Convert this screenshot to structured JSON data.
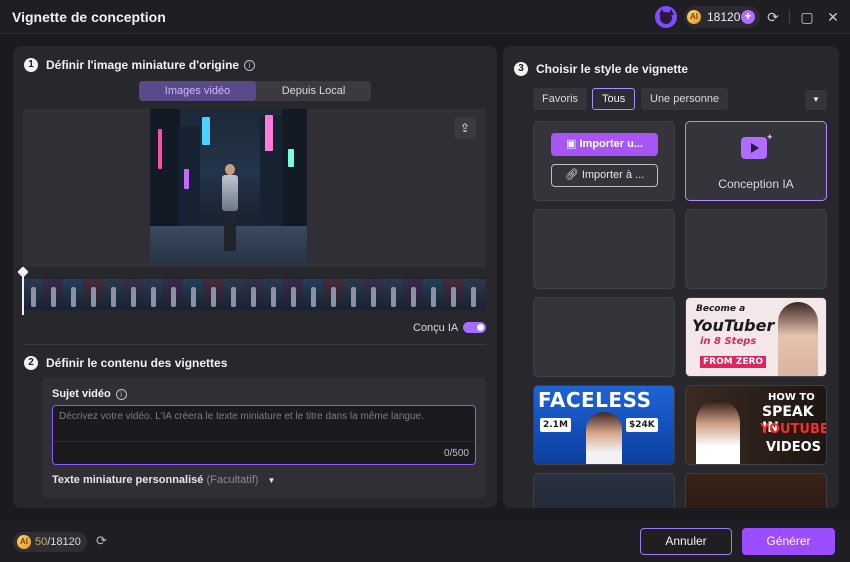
{
  "window": {
    "title": "Vignette de conception",
    "credits_balance": "18120"
  },
  "section1": {
    "number": "1",
    "title": "Définir l'image miniature d'origine",
    "tabs": [
      "Images vidéo",
      "Depuis Local"
    ],
    "active_tab": "Images vidéo",
    "toggle_label": "Conçu IA",
    "toggle_on": true
  },
  "section2": {
    "number": "2",
    "title": "Définir le contenu des vignettes",
    "subject_label": "Sujet vidéo",
    "subject_placeholder": "Décrivez votre vidéo. L'IA créera le texte miniature et le titre dans la même langue.",
    "char_count": "0/500",
    "custom_text_label": "Texte miniature personnalisé",
    "custom_text_optional": "(Facultatif)"
  },
  "section3": {
    "number": "3",
    "title": "Choisir le style de vignette",
    "filters": [
      "Favoris",
      "Tous",
      "Une personne"
    ],
    "active_filter": "Tous",
    "import_button": "Importer u...",
    "import_from_button": "Importer à ...",
    "ai_tile_label": "Conception IA",
    "thumbs": {
      "youtuber": [
        "Become a",
        "YouTuber",
        "in 8 Steps",
        "FROM ZERO"
      ],
      "faceless": [
        "FACELESS",
        "2.1M",
        "$24K"
      ],
      "speak": [
        "HOW TO",
        "SPEAK IN",
        "YOUTUBE",
        "VIDEOS"
      ]
    }
  },
  "footer": {
    "credits_used": "50",
    "credits_total": "/18120",
    "cancel": "Annuler",
    "generate": "Générer"
  },
  "colors": {
    "accent": "#9b4dff",
    "background": "#1b1b1f",
    "panel": "#27272c"
  }
}
